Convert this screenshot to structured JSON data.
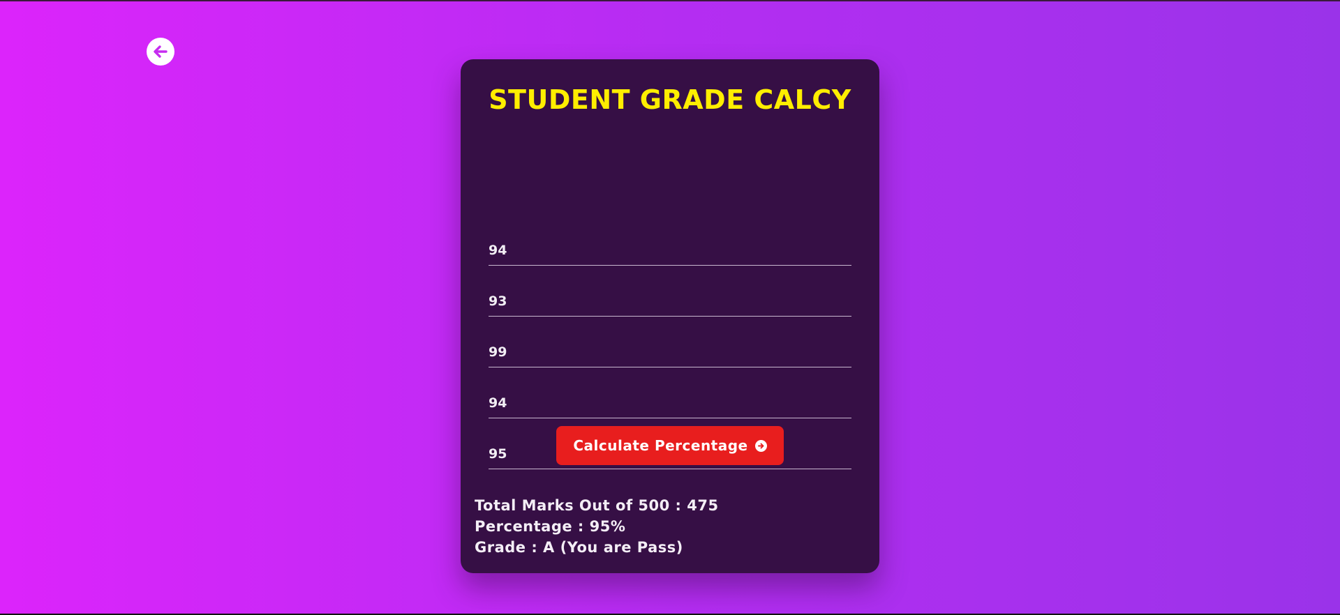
{
  "nav": {
    "back_icon": "arrow-left-circle-icon"
  },
  "calculator": {
    "title": "STUDENT GRADE CALCY",
    "marks": [
      {
        "value": "94"
      },
      {
        "value": "93"
      },
      {
        "value": "99"
      },
      {
        "value": "94"
      },
      {
        "value": "95"
      }
    ],
    "button_label": "Calculate Percentage",
    "button_icon": "arrow-right-circle-icon"
  },
  "results": {
    "total": "Total Marks Out of 500 : 475",
    "percentage": "Percentage : 95%",
    "grade": "Grade : A (You are Pass)"
  },
  "colors": {
    "background_start": "#dc24fb",
    "background_end": "#9a33e9",
    "card": "#360f45",
    "title": "#ffee00",
    "button": "#e81e1e"
  }
}
